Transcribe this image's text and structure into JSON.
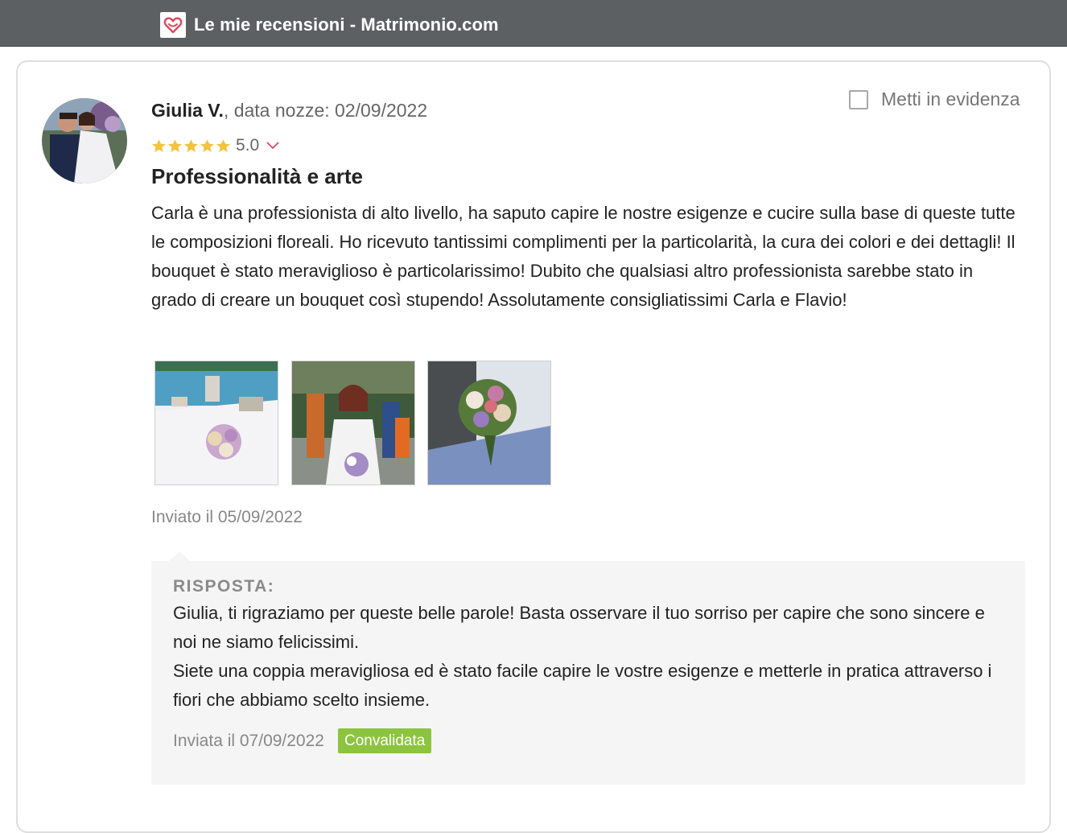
{
  "window": {
    "title": "Le mie recensioni - Matrimonio.com",
    "app_icon": "heart-icon",
    "brand_color": "#e0485a"
  },
  "review": {
    "reviewer_name": "Giulia V.",
    "wedding_date_text": ", data nozze: 02/09/2022",
    "feature_label": "Metti in evidenza",
    "feature_checked": false,
    "rating": 5,
    "score": "5.0",
    "star_color": "#f2c33c",
    "title": "Professionalità e arte",
    "body": "Carla è una professionista di alto livello, ha saputo capire le nostre esigenze e cucire sulla base di queste tutte le composizioni floreali. Ho ricevuto tantissimi complimenti per la particolarità, la cura dei colori e dei dettagli! Il bouquet è stato meraviglioso è particolarissimo! Dubito che qualsiasi altro professionista sarebbe stato in grado di creare un bouquet così stupendo! Assolutamente consigliatissimi Carla e Flavio!",
    "sent": "Inviato il 05/09/2022",
    "photos": [
      "photo-bouquet-table",
      "photo-bride",
      "photo-bouquet-closeup"
    ]
  },
  "reply": {
    "label": "RISPOSTA:",
    "paragraphs": [
      "Giulia, ti rigraziamo per queste belle parole! Basta osservare il tuo sorriso per capire che sono sincere e noi ne siamo felicissimi.",
      "Siete una coppia meravigliosa ed è stato facile capire le vostre esigenze e metterle in pratica attraverso i fiori che abbiamo scelto insieme."
    ],
    "date": "Inviata il 07/09/2022",
    "status": "Convalidata",
    "status_color": "#8cc43f"
  }
}
